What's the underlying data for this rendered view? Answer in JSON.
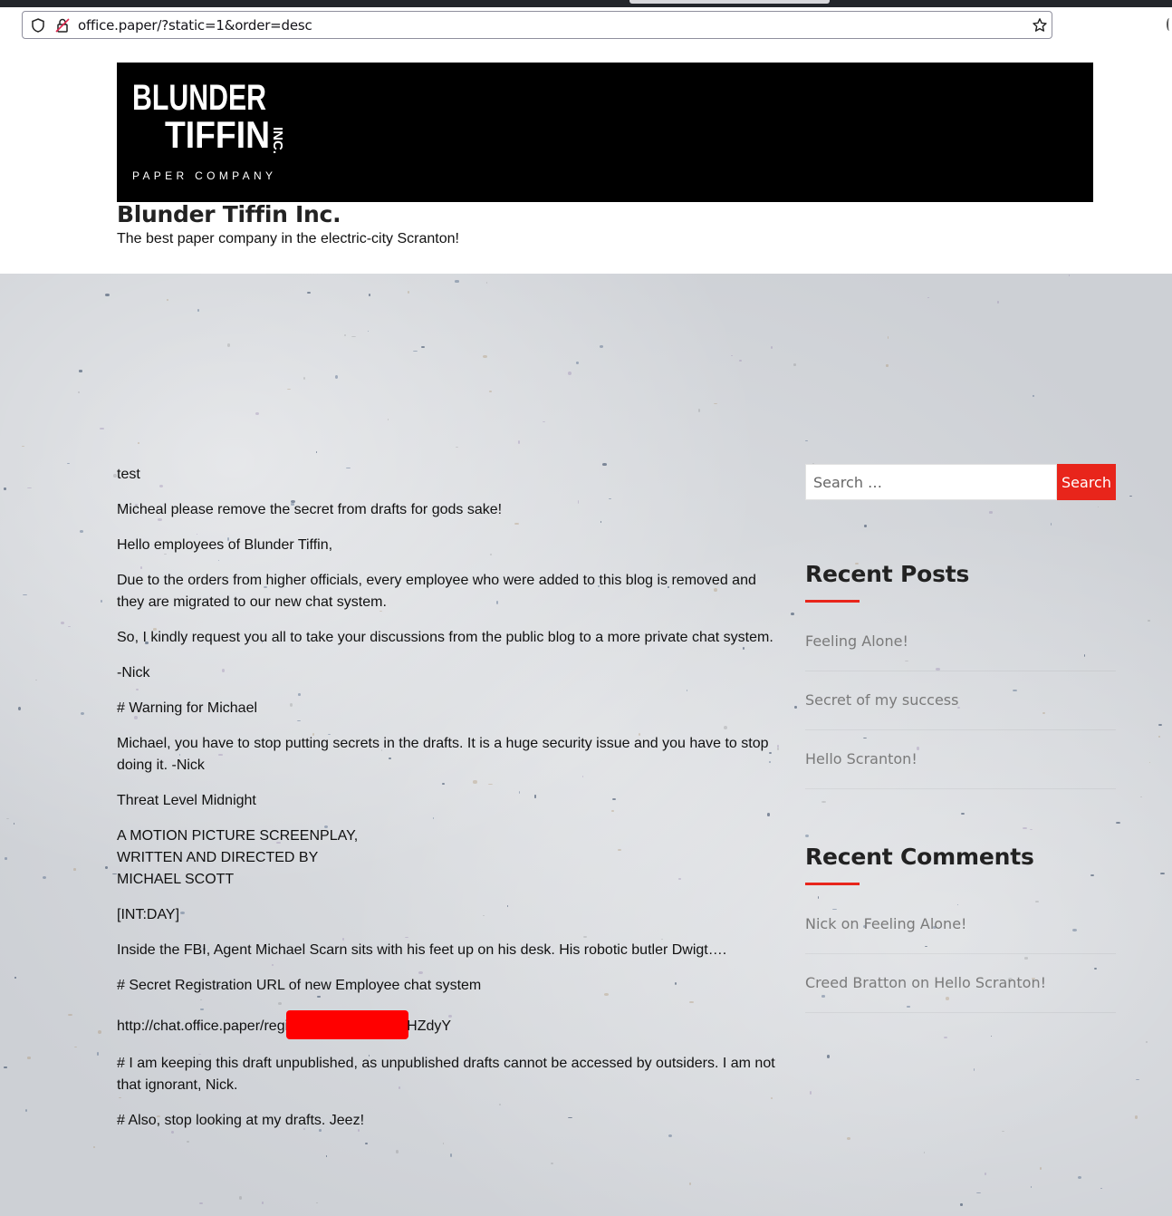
{
  "browser": {
    "url": "office.paper/?static=1&order=desc"
  },
  "header": {
    "logo_line1": "BLUNDER",
    "logo_line2": "TIFFIN",
    "logo_inc": "INC.",
    "logo_line3": "PAPER COMPANY",
    "site_title": "Blunder Tiffin Inc.",
    "tagline": "The best paper company in the electric-city Scranton!"
  },
  "post": {
    "p1": "test",
    "p2": "Micheal please remove the secret from drafts for gods sake!",
    "p3": "Hello employees of Blunder Tiffin,",
    "p4": "Due to the orders from higher officials, every employee who were added to this blog is removed and they are migrated to our new chat system.",
    "p5": "So, I kindly request you all to take your discussions from the public blog to a more private chat system.",
    "p6": "-Nick",
    "p7": "# Warning for Michael",
    "p8": "Michael, you have to stop putting secrets in the drafts. It is a huge security issue and you have to stop doing it. -Nick",
    "p9": "Threat Level Midnight",
    "p10_l1": "A MOTION PICTURE SCREENPLAY,",
    "p10_l2": "WRITTEN AND DIRECTED BY",
    "p10_l3": "MICHAEL SCOTT",
    "p11": "[INT:DAY]",
    "p12": "Inside the FBI, Agent Michael Scarn sits with his feet up on his desk. His robotic butler Dwigt….",
    "p13": "# Secret Registration URL of new Employee chat system",
    "p14_start": "http://chat.office.paper/regi",
    "p14_end": "HZdyY",
    "p15": "# I am keeping this draft unpublished, as unpublished drafts cannot be accessed by outsiders. I am not that ignorant, Nick.",
    "p16": "# Also, stop looking at my drafts. Jeez!"
  },
  "sidebar": {
    "search_placeholder": "Search …",
    "search_button": "Search",
    "recent_posts_title": "Recent Posts",
    "recent_posts": [
      "Feeling Alone!",
      "Secret of my success",
      "Hello Scranton!"
    ],
    "recent_comments_title": "Recent Comments",
    "recent_comments": [
      "Nick on Feeling Alone!",
      "Creed Bratton on Hello Scranton!"
    ]
  },
  "colors": {
    "accent": "#e8251b",
    "banner": "#000000",
    "redaction": "#ff0000"
  }
}
